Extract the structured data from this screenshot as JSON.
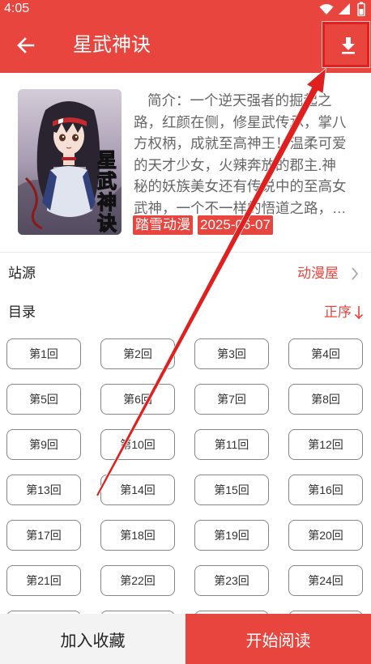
{
  "status_bar": {
    "time": "4:05"
  },
  "app_bar": {
    "title": "星武神诀"
  },
  "comic": {
    "cover_lettering": [
      "星",
      "武",
      "神",
      "诀"
    ],
    "description_lines": [
      "简介：一个逆天强者的掘起之",
      "路，红颜在侧，修星武传承，掌八",
      "方权柄，成就至高神王！温柔可爱",
      "的天才少女，火辣奔放的郡主.神",
      "秘的妖族美女还有传说中的至高女",
      "武神，一个不一样的悟道之路，…"
    ],
    "author": "踏雪动漫",
    "date": "2025-06-07"
  },
  "source": {
    "label": "站源",
    "value": "动漫屋"
  },
  "catalog": {
    "label": "目录",
    "order": "正序"
  },
  "episodes": [
    "第1回",
    "第2回",
    "第3回",
    "第4回",
    "第5回",
    "第6回",
    "第7回",
    "第8回",
    "第9回",
    "第10回",
    "第11回",
    "第12回",
    "第13回",
    "第14回",
    "第15回",
    "第16回",
    "第17回",
    "第18回",
    "第19回",
    "第20回",
    "第21回",
    "第22回",
    "第23回",
    "第24回"
  ],
  "bottom_bar": {
    "favorite": "加入收藏",
    "read": "开始阅读"
  },
  "icons": {
    "back": "arrow-left-icon",
    "download": "download-icon",
    "source_chevron": "chevron-right-icon",
    "sort": "arrow-down-icon",
    "wifi": "wifi-icon",
    "signal": "signal-icon",
    "battery": "battery-icon"
  },
  "colors": {
    "primary": "#e8453f",
    "annotation": "#e01f1f"
  }
}
